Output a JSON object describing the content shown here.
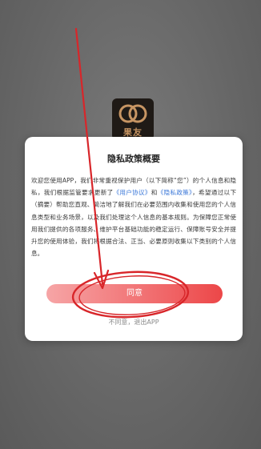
{
  "app": {
    "logo_text": "果友"
  },
  "dialog": {
    "title": "隐私政策概要",
    "body": {
      "p1": "欢迎您使用APP，我们非常重视保护用户（以下简称“您”）的个人信息和隐私，我们根据监管要求更新了",
      "link1": "《用户协议》",
      "p2": "和",
      "link2": "《隐私政策》",
      "p3": "，希望通过以下（摘要）帮助您直观、简洁地了解我们在必要范围内收集和使用您的个人信息类型和业务场景，以及我们处理这个人信息的基本规则。为保障您正常使用我们提供的各项服务、维护平台基础功能的稳定运行、保障账号安全并提升您的使用体验，我们将根据合法、正当、必要原则收集以下类别的个人信息。"
    },
    "agree_label": "同意",
    "decline_label": "不同意，退出APP"
  },
  "colors": {
    "accent": "#f06466",
    "link": "#3a77d8",
    "annotation": "#d8262a"
  },
  "icons": {
    "logo": "twin-circles-logo-icon"
  }
}
